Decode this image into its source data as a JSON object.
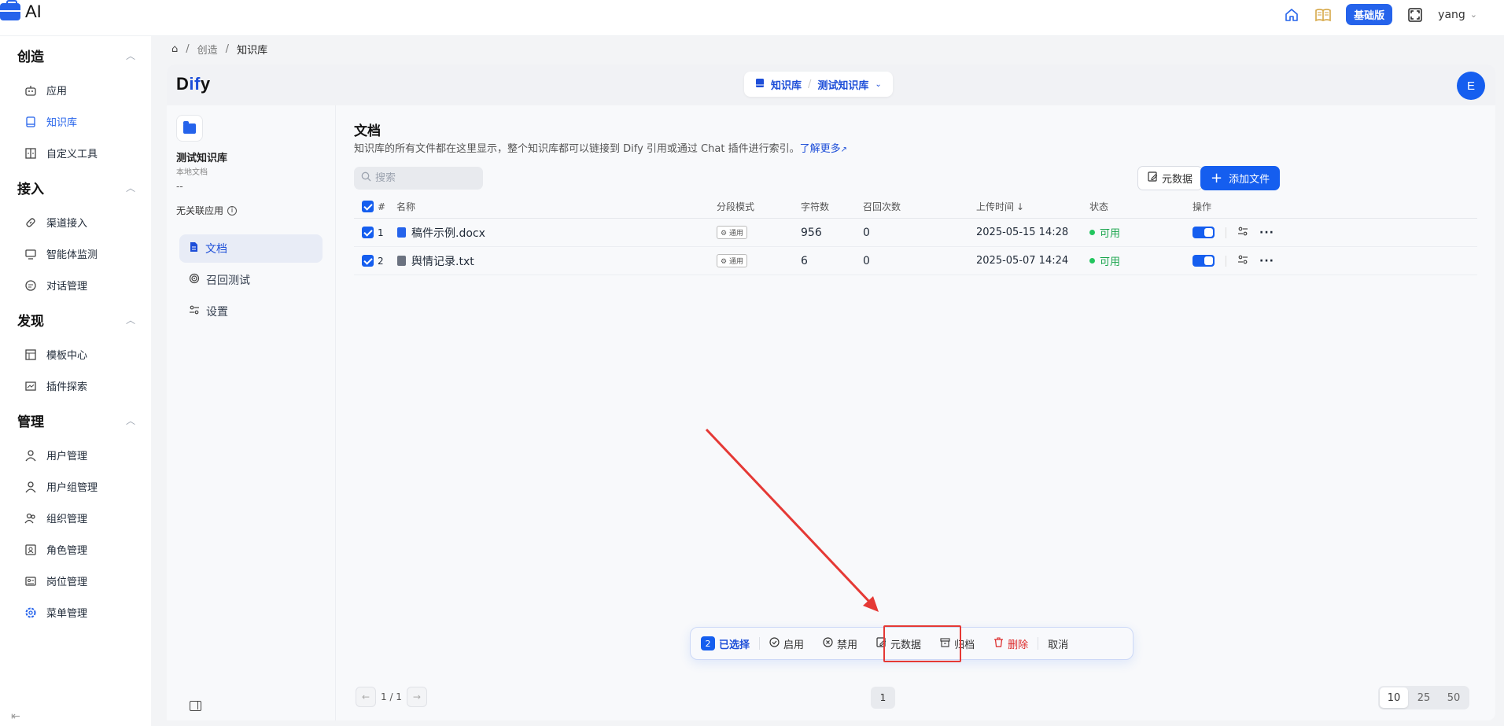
{
  "app": {
    "title": "AI",
    "plan_badge": "基础版",
    "username": "yang"
  },
  "sidebar": {
    "groups": [
      {
        "label": "创造",
        "items": [
          "应用",
          "知识库",
          "自定义工具"
        ]
      },
      {
        "label": "接入",
        "items": [
          "渠道接入",
          "智能体监测",
          "对话管理"
        ]
      },
      {
        "label": "发现",
        "items": [
          "模板中心",
          "插件探索"
        ]
      },
      {
        "label": "管理",
        "items": [
          "用户管理",
          "用户组管理",
          "组织管理",
          "角色管理",
          "岗位管理",
          "菜单管理"
        ]
      }
    ]
  },
  "breadcrumb": {
    "home": "⌂",
    "level1": "创造",
    "current": "知识库"
  },
  "dify": {
    "logo_left": "D",
    "logo_mid": "if",
    "logo_right": "y",
    "switch_root": "知识库",
    "switch_current": "测试知识库",
    "avatar": "E"
  },
  "kb": {
    "name": "测试知识库",
    "source": "本地文档",
    "dash": "--",
    "no_app": "无关联应用",
    "nav": [
      "文档",
      "召回测试",
      "设置"
    ]
  },
  "docs": {
    "title": "文档",
    "description": "知识库的所有文件都在这里显示，整个知识库都可以链接到 Dify 引用或通过 Chat 插件进行索引。",
    "learn_more": "了解更多",
    "search_placeholder": "搜索",
    "meta_button": "元数据",
    "add_button": "添加文件",
    "columns": {
      "num": "#",
      "name": "名称",
      "mode": "分段模式",
      "chars": "字符数",
      "recalls": "召回次数",
      "uploaded": "上传时间",
      "status": "状态",
      "actions": "操作"
    },
    "rows": [
      {
        "num": "1",
        "name": "稿件示例.docx",
        "mode": "通用",
        "chars": "956",
        "recalls": "0",
        "uploaded": "2025-05-15 14:28",
        "status": "可用"
      },
      {
        "num": "2",
        "name": "舆情记录.txt",
        "mode": "通用",
        "chars": "6",
        "recalls": "0",
        "uploaded": "2025-05-07 14:24",
        "status": "可用"
      }
    ]
  },
  "bulk": {
    "count": "2",
    "selected": "已选择",
    "enable": "启用",
    "disable": "禁用",
    "metadata": "元数据",
    "archive": "归档",
    "delete": "删除",
    "cancel": "取消"
  },
  "pagination": {
    "pages": "1 / 1",
    "current": "1",
    "sizes": [
      "10",
      "25",
      "50"
    ]
  },
  "colors": {
    "accent": "#155eef",
    "status_ok": "#16a34a",
    "danger": "#dc2626",
    "annotation": "#e53935"
  }
}
